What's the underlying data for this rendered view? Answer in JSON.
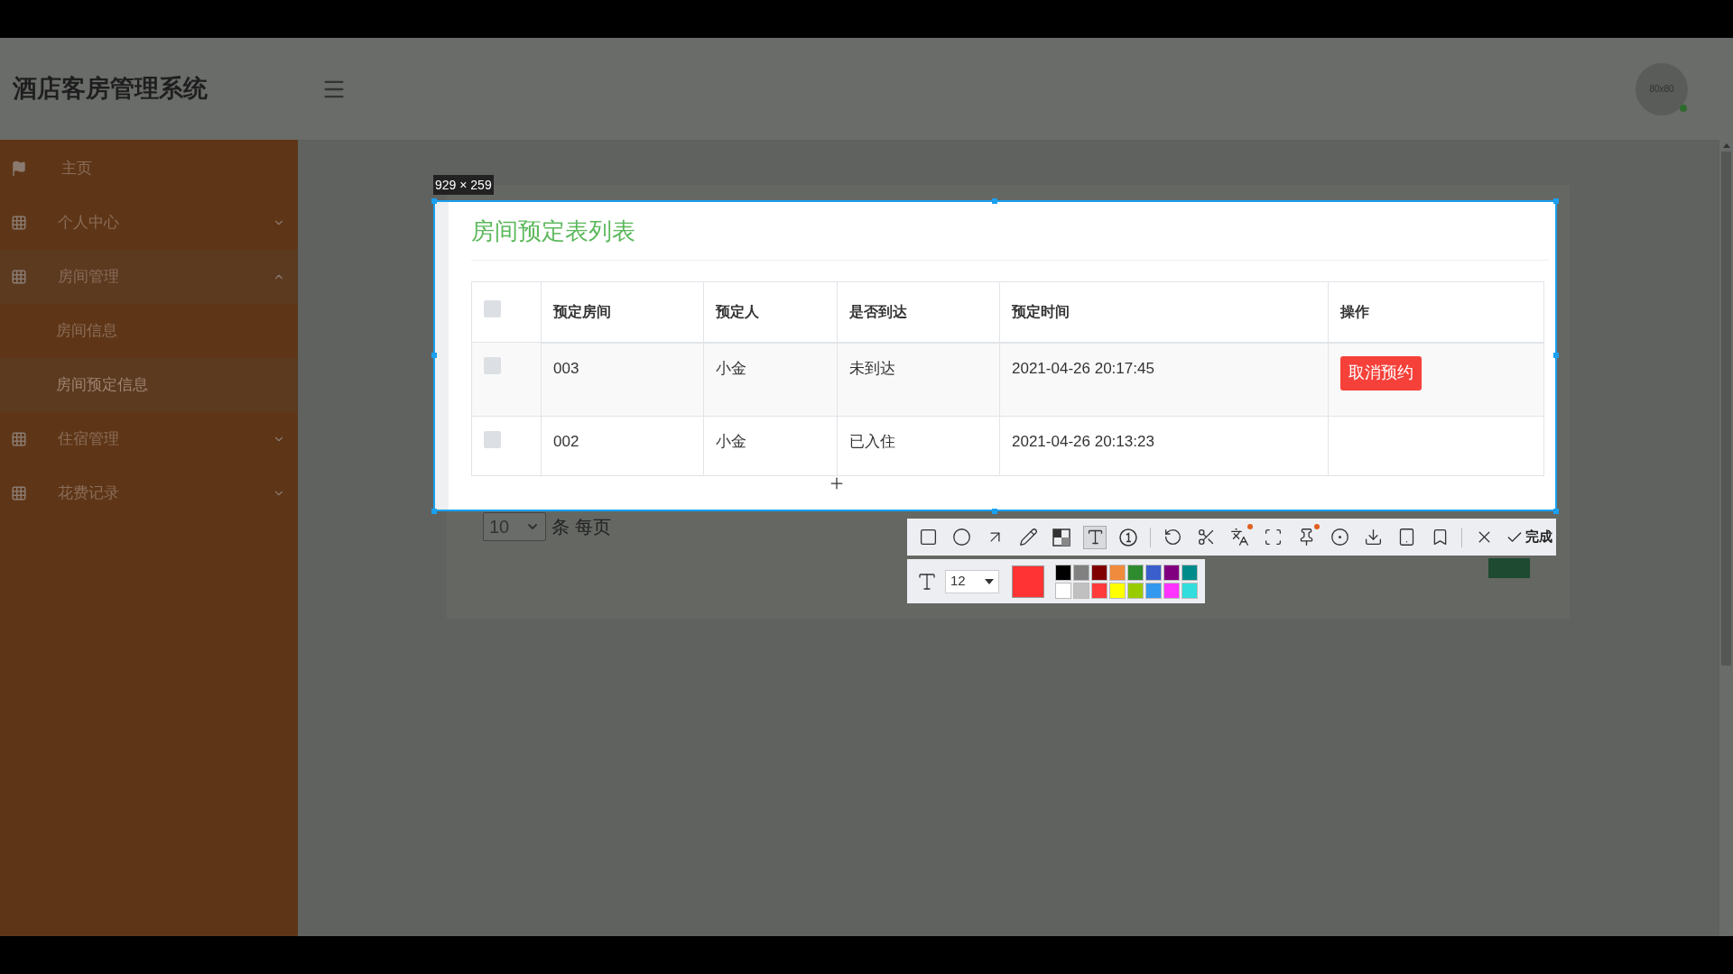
{
  "header": {
    "title": "酒店客房管理系统",
    "avatar_text": "80x80"
  },
  "sidebar": {
    "items": [
      {
        "label": "主页",
        "kind": "link",
        "selected": false
      },
      {
        "label": "个人中心",
        "kind": "group",
        "expanded": false,
        "selected": false
      },
      {
        "label": "房间管理",
        "kind": "group",
        "expanded": true,
        "selected": false,
        "children": [
          {
            "label": "房间信息",
            "selected": false
          },
          {
            "label": "房间预定信息",
            "selected": true
          }
        ]
      },
      {
        "label": "住宿管理",
        "kind": "group",
        "expanded": false,
        "selected": false
      },
      {
        "label": "花费记录",
        "kind": "group",
        "expanded": false,
        "selected": false
      }
    ]
  },
  "card": {
    "title": "房间预定表列表",
    "columns": [
      "预定房间",
      "预定人",
      "是否到达",
      "预定时间",
      "操作"
    ],
    "all_checked": false,
    "rows": [
      {
        "checked": false,
        "cells": [
          "003",
          "小金",
          "未到达",
          "2021-04-26 20:17:45"
        ],
        "action": "取消预约"
      },
      {
        "checked": false,
        "cells": [
          "002",
          "小金",
          "已入住",
          "2021-04-26 20:13:23"
        ]
      }
    ],
    "page_size": "10",
    "page_size_label": "条 每页"
  },
  "capture": {
    "size_label": "929 × 259",
    "tools": [
      {
        "selected": false
      },
      {
        "selected": false
      },
      {
        "selected": false
      },
      {
        "selected": false
      },
      {
        "selected": false
      },
      {
        "selected": true
      },
      {
        "selected": false
      },
      {
        "selected": false
      },
      {
        "selected": false
      },
      {
        "selected": false,
        "badge": true
      },
      {
        "selected": false
      },
      {
        "selected": false,
        "badge": true
      },
      {
        "selected": false
      },
      {
        "selected": false
      },
      {
        "selected": false
      },
      {
        "selected": false
      },
      {
        "selected": false
      }
    ],
    "done_label": "完成",
    "font_size": "12",
    "current": {
      "color": "#ff3333"
    },
    "palette": [
      {
        "color": "#000000"
      },
      {
        "color": "#808080"
      },
      {
        "color": "#800000"
      },
      {
        "color": "#f08a3c"
      },
      {
        "color": "#2e8b2e"
      },
      {
        "color": "#3a5fcd"
      },
      {
        "color": "#800080"
      },
      {
        "color": "#008b8b"
      },
      {
        "color": "#ffffff"
      },
      {
        "color": "#c0c0c0"
      },
      {
        "color": "#ff3b3b"
      },
      {
        "color": "#ffff00"
      },
      {
        "color": "#99cc00"
      },
      {
        "color": "#3399ee"
      },
      {
        "color": "#ff33ff"
      },
      {
        "color": "#33dddd"
      }
    ]
  }
}
